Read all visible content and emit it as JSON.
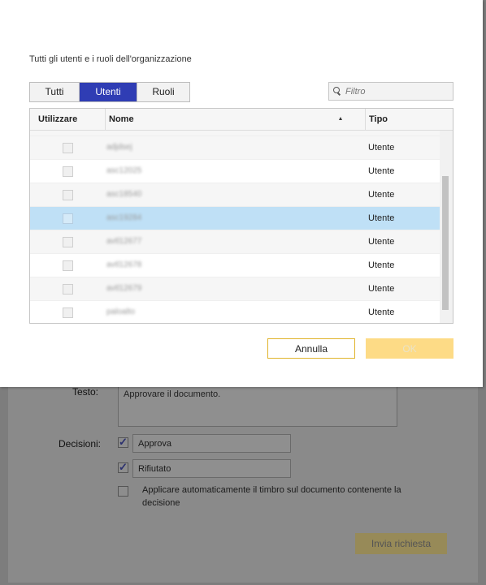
{
  "modal": {
    "subtitle": "Tutti gli utenti e i ruoli dell'organizzazione",
    "tabs": [
      {
        "label": "Tutti",
        "active": false
      },
      {
        "label": "Utenti",
        "active": true
      },
      {
        "label": "Ruoli",
        "active": false
      }
    ],
    "filter_placeholder": "Filtro",
    "grid": {
      "columns": {
        "use": "Utilizzare",
        "name": "Nome",
        "type": "Tipo"
      },
      "sort_column": "Nome",
      "sort_direction": "ascending",
      "rows": [
        {
          "name": "adjdsej",
          "type": "Utente",
          "checked": false,
          "selected": false
        },
        {
          "name": "asc12025",
          "type": "Utente",
          "checked": false,
          "selected": false
        },
        {
          "name": "asc18540",
          "type": "Utente",
          "checked": false,
          "selected": false
        },
        {
          "name": "asc19284",
          "type": "Utente",
          "checked": false,
          "selected": true
        },
        {
          "name": "avtl12677",
          "type": "Utente",
          "checked": false,
          "selected": false
        },
        {
          "name": "avtl12678",
          "type": "Utente",
          "checked": false,
          "selected": false
        },
        {
          "name": "avtl12679",
          "type": "Utente",
          "checked": false,
          "selected": false
        },
        {
          "name": "paloalto",
          "type": "Utente",
          "checked": false,
          "selected": false
        }
      ]
    },
    "buttons": {
      "cancel": "Annulla",
      "ok": "OK"
    }
  },
  "background_form": {
    "text_label": "Testo:",
    "text_value": "Approvare il documento.",
    "decisions_label": "Decisioni:",
    "decisions": [
      {
        "label": "Approva",
        "checked": true
      },
      {
        "label": "Rifiutato",
        "checked": true
      }
    ],
    "auto_stamp_label": "Applicare automaticamente il timbro sul documento contenente la decisione",
    "auto_stamp_checked": false,
    "submit_label": "Invia richiesta"
  },
  "colors": {
    "tab_active": "#2f3db4",
    "row_selected": "#bfe0f6",
    "button_accent": "#e0b42c",
    "ok_disabled": "#fddb86"
  }
}
